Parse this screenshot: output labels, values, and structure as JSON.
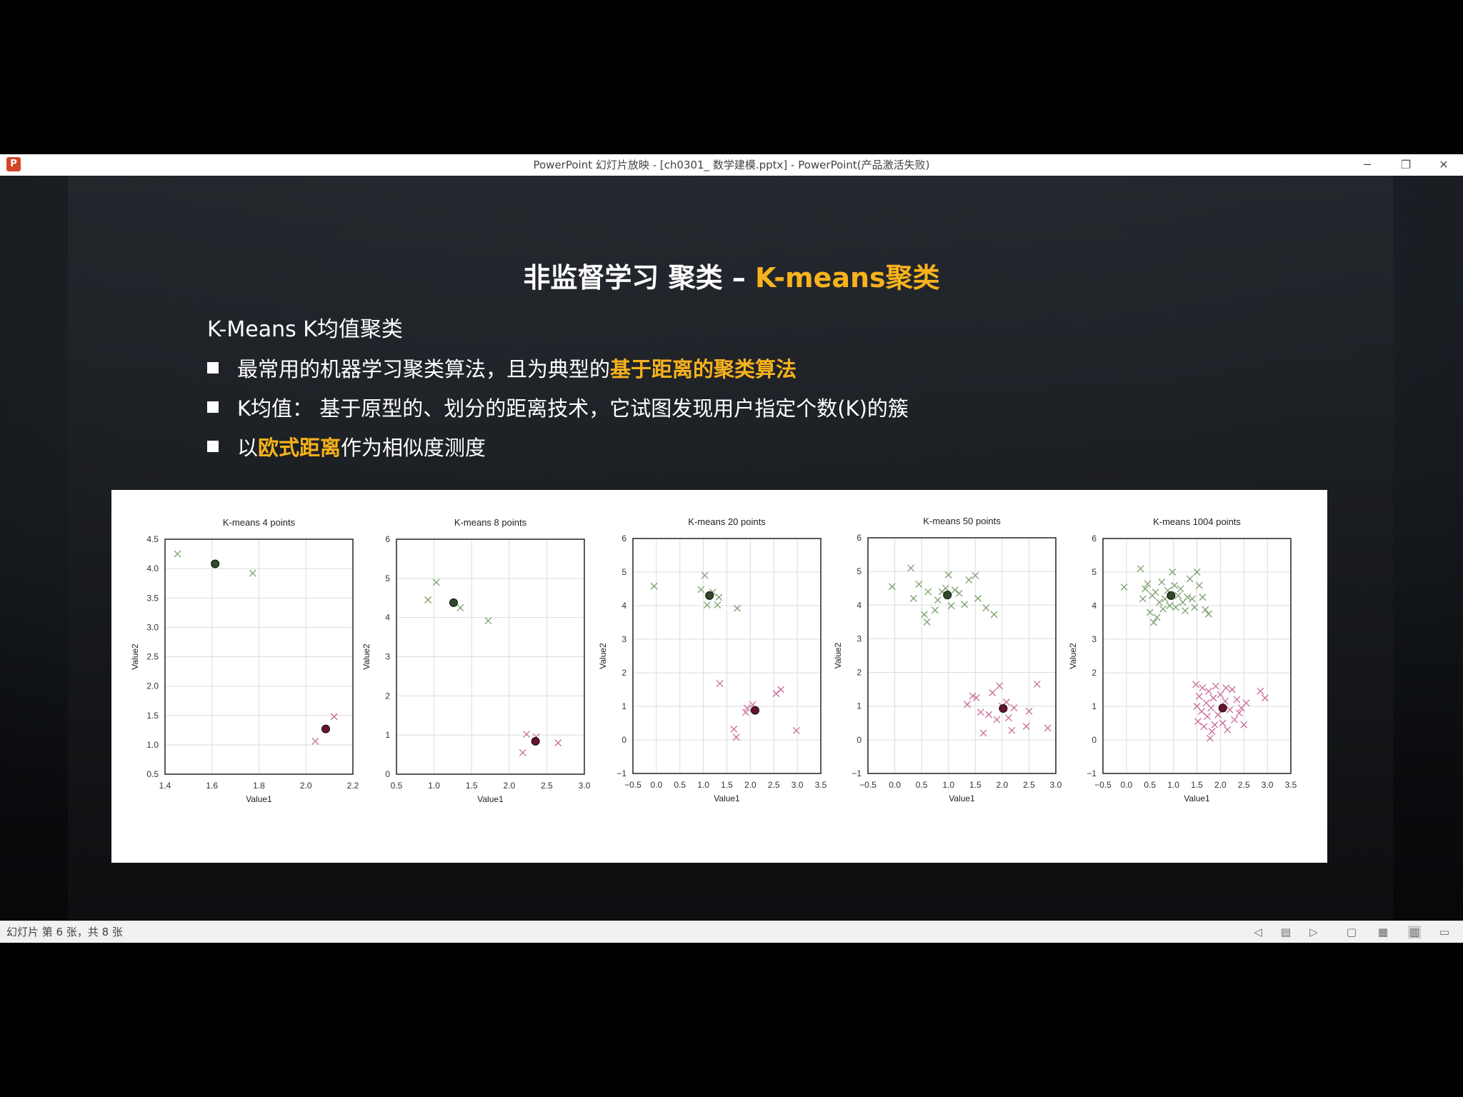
{
  "window": {
    "title": "PowerPoint 幻灯片放映 - [ch0301_ 数学建模.pptx] - PowerPoint(产品激活失败)",
    "app_icon_label": "P",
    "minimize": "─",
    "restore": "❐",
    "close": "✕"
  },
  "slide": {
    "title_main": "非监督学习 聚类 – ",
    "title_accent": "K-means聚类",
    "subtitle": "K-Means K均值聚类",
    "bullet1_a": "最常用的机器学习聚类算法，且为典型的",
    "bullet1_b": "基于距离的聚类算法",
    "bullet2": "K均值： 基于原型的、划分的距离技术，它试图发现用户指定个数(K)的簇",
    "bullet3_a": "以",
    "bullet3_b": "欧式距离",
    "bullet3_c": "作为相似度测度"
  },
  "status": {
    "slide_info": "幻灯片 第 6 张，共 8 张",
    "icons": [
      "prev-icon",
      "notes-icon",
      "next-icon",
      "normal-view-icon",
      "sorter-view-icon",
      "reading-view-icon",
      "slideshow-icon"
    ]
  },
  "colors": {
    "accent": "#f7b21c",
    "cluster_green": "#2e4a2a",
    "cluster_green_light": "#7aa06c",
    "cluster_red": "#6a1030",
    "cluster_red_light": "#c86a9a"
  },
  "chart_data": [
    {
      "type": "scatter",
      "title": "K-means  4 points",
      "xlabel": "Value1",
      "ylabel": "Value2",
      "xlim": [
        1.3,
        2.2
      ],
      "ylim": [
        0.5,
        4.5
      ],
      "xticks": [
        "1.4",
        "1.6",
        "1.8",
        "2.0",
        "2.2"
      ],
      "yticks": [
        "0.5",
        "1.0",
        "1.5",
        "2.0",
        "2.5",
        "3.0",
        "3.5",
        "4.0",
        "4.5"
      ],
      "points": [
        [
          1.36,
          4.25,
          0
        ],
        [
          1.72,
          3.92,
          0
        ],
        [
          2.02,
          1.06,
          1
        ],
        [
          2.11,
          1.48,
          1
        ]
      ],
      "centroids": [
        [
          1.54,
          4.08,
          0
        ],
        [
          2.07,
          1.27,
          1
        ]
      ]
    },
    {
      "type": "scatter",
      "title": "K-means  8 points",
      "xlabel": "Value1",
      "ylabel": "Value2",
      "xlim": [
        0.5,
        3.0
      ],
      "ylim": [
        0,
        6
      ],
      "xticks": [
        "0.5",
        "1.0",
        "1.5",
        "2.0",
        "2.5",
        "3.0"
      ],
      "yticks": [
        "0",
        "1",
        "2",
        "3",
        "4",
        "5",
        "6"
      ],
      "points": [
        [
          0.92,
          4.45,
          0
        ],
        [
          1.03,
          4.9,
          0
        ],
        [
          1.35,
          4.25,
          0
        ],
        [
          1.72,
          3.92,
          0
        ],
        [
          2.18,
          0.55,
          1
        ],
        [
          2.23,
          1.02,
          1
        ],
        [
          2.36,
          0.95,
          1
        ],
        [
          2.65,
          0.8,
          1
        ]
      ],
      "centroids": [
        [
          1.26,
          4.38,
          0
        ],
        [
          2.35,
          0.84,
          1
        ]
      ]
    },
    {
      "type": "scatter",
      "title": "K-means  20 points",
      "xlabel": "Value1",
      "ylabel": "Value2",
      "xlim": [
        -0.5,
        3.5
      ],
      "ylim": [
        -1,
        6
      ],
      "xticks": [
        "−0.5",
        "0.0",
        "0.5",
        "1.0",
        "1.5",
        "2.0",
        "2.5",
        "3.0",
        "3.5"
      ],
      "yticks": [
        "−1",
        "0",
        "1",
        "2",
        "3",
        "4",
        "5",
        "6"
      ],
      "points": [
        [
          -0.05,
          4.58,
          0
        ],
        [
          0.95,
          4.48,
          0
        ],
        [
          1.03,
          4.9,
          0
        ],
        [
          1.08,
          4.02,
          0
        ],
        [
          1.2,
          4.4,
          0
        ],
        [
          1.33,
          4.25,
          0
        ],
        [
          1.3,
          4.02,
          0
        ],
        [
          1.72,
          3.92,
          0
        ],
        [
          1.35,
          1.68,
          1
        ],
        [
          1.65,
          0.32,
          1
        ],
        [
          1.7,
          0.08,
          1
        ],
        [
          1.9,
          0.82,
          1
        ],
        [
          1.93,
          0.95,
          1
        ],
        [
          2.05,
          1.05,
          1
        ],
        [
          2.55,
          1.38,
          1
        ],
        [
          2.65,
          1.5,
          1
        ],
        [
          2.98,
          0.28,
          1
        ]
      ],
      "centroids": [
        [
          1.13,
          4.3,
          0
        ],
        [
          2.1,
          0.88,
          1
        ]
      ]
    },
    {
      "type": "scatter",
      "title": "K-means  50 points",
      "xlabel": "Value1",
      "ylabel": "Value2",
      "xlim": [
        -0.5,
        3.0
      ],
      "ylim": [
        -1,
        6
      ],
      "xticks": [
        "−0.5",
        "0.0",
        "0.5",
        "1.0",
        "1.5",
        "2.0",
        "2.5",
        "3.0"
      ],
      "yticks": [
        "−1",
        "0",
        "1",
        "2",
        "3",
        "4",
        "5",
        "6"
      ],
      "points": [
        [
          -0.05,
          4.55,
          0
        ],
        [
          0.3,
          5.1,
          0
        ],
        [
          0.35,
          4.2,
          0
        ],
        [
          0.45,
          4.62,
          0
        ],
        [
          0.55,
          3.72,
          0
        ],
        [
          0.6,
          3.5,
          0
        ],
        [
          0.62,
          4.4,
          0
        ],
        [
          0.75,
          3.85,
          0
        ],
        [
          0.8,
          4.15,
          0
        ],
        [
          0.88,
          4.4,
          0
        ],
        [
          0.95,
          4.5,
          0
        ],
        [
          1.0,
          4.9,
          0
        ],
        [
          1.05,
          3.98,
          0
        ],
        [
          1.12,
          4.45,
          0
        ],
        [
          1.2,
          4.35,
          0
        ],
        [
          1.3,
          4.02,
          0
        ],
        [
          1.38,
          4.75,
          0
        ],
        [
          1.5,
          4.88,
          0
        ],
        [
          1.55,
          4.2,
          0
        ],
        [
          1.7,
          3.92,
          0
        ],
        [
          1.85,
          3.72,
          0
        ],
        [
          1.35,
          1.05,
          1
        ],
        [
          1.45,
          1.3,
          1
        ],
        [
          1.52,
          1.25,
          1
        ],
        [
          1.6,
          0.82,
          1
        ],
        [
          1.65,
          0.2,
          1
        ],
        [
          1.75,
          0.75,
          1
        ],
        [
          1.82,
          1.4,
          1
        ],
        [
          1.9,
          0.6,
          1
        ],
        [
          1.95,
          1.6,
          1
        ],
        [
          2.0,
          1.0,
          1
        ],
        [
          2.08,
          1.12,
          1
        ],
        [
          2.12,
          0.65,
          1
        ],
        [
          2.18,
          0.28,
          1
        ],
        [
          2.22,
          0.95,
          1
        ],
        [
          2.45,
          0.4,
          1
        ],
        [
          2.5,
          0.85,
          1
        ],
        [
          2.65,
          1.65,
          1
        ],
        [
          2.85,
          0.35,
          1
        ]
      ],
      "centroids": [
        [
          0.98,
          4.3,
          0
        ],
        [
          2.02,
          0.93,
          1
        ]
      ]
    },
    {
      "type": "scatter",
      "title": "K-means  1004 points",
      "xlabel": "Value1",
      "ylabel": "Value2",
      "xlim": [
        -0.5,
        3.5
      ],
      "ylim": [
        -1,
        6
      ],
      "xticks": [
        "−0.5",
        "0.0",
        "0.5",
        "1.0",
        "1.5",
        "2.0",
        "2.5",
        "3.0",
        "3.5"
      ],
      "yticks": [
        "−1",
        "0",
        "1",
        "2",
        "3",
        "4",
        "5",
        "6"
      ],
      "points": [
        [
          -0.05,
          4.55,
          0
        ],
        [
          0.3,
          5.1,
          0
        ],
        [
          0.35,
          4.2,
          0
        ],
        [
          0.4,
          4.5,
          0
        ],
        [
          0.45,
          4.65,
          0
        ],
        [
          0.5,
          3.8,
          0
        ],
        [
          0.55,
          4.3,
          0
        ],
        [
          0.58,
          3.5,
          0
        ],
        [
          0.62,
          4.4,
          0
        ],
        [
          0.65,
          3.65,
          0
        ],
        [
          0.7,
          4.1,
          0
        ],
        [
          0.75,
          4.7,
          0
        ],
        [
          0.78,
          3.9,
          0
        ],
        [
          0.82,
          4.2,
          0
        ],
        [
          0.88,
          4.45,
          0
        ],
        [
          0.92,
          4.0,
          0
        ],
        [
          0.98,
          5.0,
          0
        ],
        [
          1.02,
          4.6,
          0
        ],
        [
          1.05,
          3.95,
          0
        ],
        [
          1.1,
          4.3,
          0
        ],
        [
          1.15,
          4.5,
          0
        ],
        [
          1.2,
          4.1,
          0
        ],
        [
          1.25,
          3.85,
          0
        ],
        [
          1.3,
          4.25,
          0
        ],
        [
          1.35,
          4.8,
          0
        ],
        [
          1.4,
          4.2,
          0
        ],
        [
          1.45,
          3.95,
          0
        ],
        [
          1.5,
          5.0,
          0
        ],
        [
          1.55,
          4.6,
          0
        ],
        [
          1.62,
          4.25,
          0
        ],
        [
          1.68,
          3.88,
          0
        ],
        [
          1.75,
          3.75,
          0
        ],
        [
          1.48,
          1.65,
          1
        ],
        [
          1.5,
          1.0,
          1
        ],
        [
          1.52,
          0.55,
          1
        ],
        [
          1.55,
          1.3,
          1
        ],
        [
          1.6,
          0.85,
          1
        ],
        [
          1.62,
          1.55,
          1
        ],
        [
          1.65,
          0.4,
          1
        ],
        [
          1.7,
          1.1,
          1
        ],
        [
          1.72,
          0.7,
          1
        ],
        [
          1.75,
          1.45,
          1
        ],
        [
          1.78,
          0.05,
          1
        ],
        [
          1.8,
          0.95,
          1
        ],
        [
          1.85,
          1.25,
          1
        ],
        [
          1.88,
          0.45,
          1
        ],
        [
          1.9,
          1.6,
          1
        ],
        [
          1.95,
          0.75,
          1
        ],
        [
          2.0,
          1.35,
          1
        ],
        [
          2.05,
          0.5,
          1
        ],
        [
          2.1,
          1.15,
          1
        ],
        [
          2.15,
          0.3,
          1
        ],
        [
          2.2,
          0.9,
          1
        ],
        [
          2.25,
          1.5,
          1
        ],
        [
          2.3,
          0.6,
          1
        ],
        [
          2.35,
          1.2,
          1
        ],
        [
          2.4,
          0.8,
          1
        ],
        [
          2.45,
          0.95,
          1
        ],
        [
          2.5,
          0.45,
          1
        ],
        [
          2.55,
          1.1,
          1
        ],
        [
          2.85,
          1.45,
          1
        ],
        [
          2.95,
          1.25,
          1
        ],
        [
          1.82,
          0.25,
          1
        ],
        [
          2.12,
          1.55,
          1
        ]
      ],
      "centroids": [
        [
          0.95,
          4.3,
          0
        ],
        [
          2.05,
          0.95,
          1
        ]
      ]
    }
  ]
}
